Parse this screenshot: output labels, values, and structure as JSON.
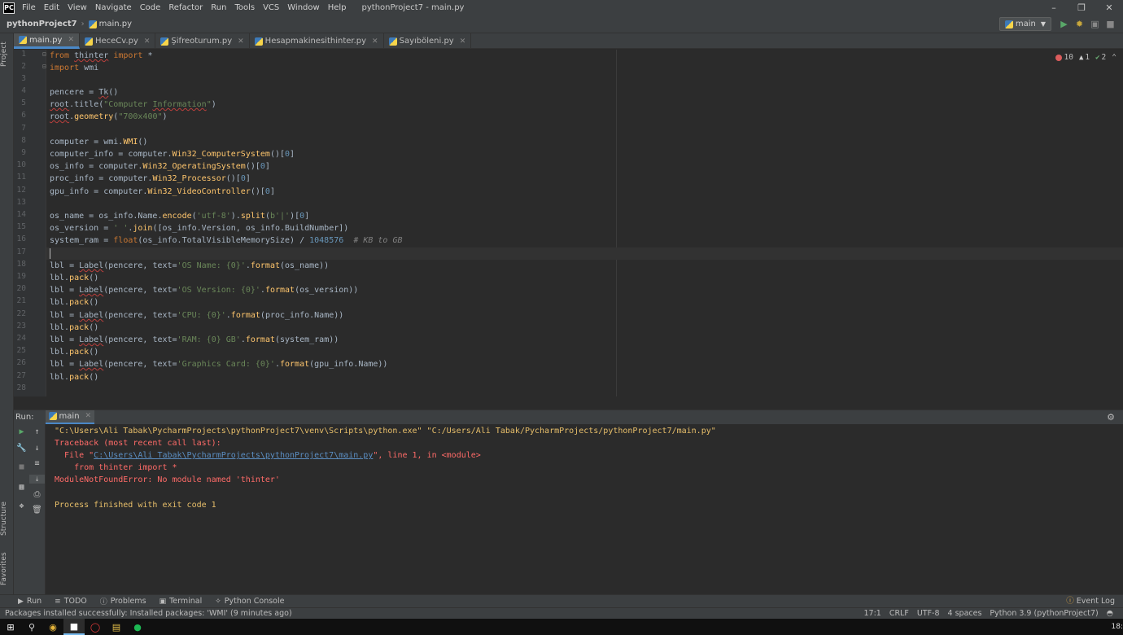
{
  "menubar": {
    "items": [
      "File",
      "Edit",
      "View",
      "Navigate",
      "Code",
      "Refactor",
      "Run",
      "Tools",
      "VCS",
      "Window",
      "Help"
    ],
    "window_title": "pythonProject7 - main.py"
  },
  "navbar": {
    "project": "pythonProject7",
    "file": "main.py",
    "run_config": "main"
  },
  "left_strip": {
    "project": "Project",
    "structure": "Structure",
    "favorites": "Favorites"
  },
  "tabs": [
    "main.py",
    "HeceCv.py",
    "Şifreoturum.py",
    "Hesapmakinesithinter.py",
    "Sayıböleni.py"
  ],
  "inspections": {
    "errors": "10",
    "warnings": "1",
    "typos": "2"
  },
  "run_panel": {
    "title": "Run:",
    "tab": "main",
    "lines": {
      "cmd": "\"C:\\Users\\Ali Tabak\\PycharmProjects\\pythonProject7\\venv\\Scripts\\python.exe\" \"C:/Users/Ali Tabak/PycharmProjects/pythonProject7/main.py\"",
      "traceback": "Traceback (most recent call last):",
      "file_pre": "  File \"",
      "file_link": "C:\\Users\\Ali Tabak\\PycharmProjects\\pythonProject7\\main.py",
      "file_post": "\", line 1, in <module>",
      "src": "    from thinter import *",
      "error": "ModuleNotFoundError: No module named 'thinter'",
      "exit": "Process finished with exit code 1"
    }
  },
  "toolwindows": [
    "Run",
    "TODO",
    "Problems",
    "Terminal",
    "Python Console"
  ],
  "event_log": "Event Log",
  "status": {
    "message": "Packages installed successfully: Installed packages: 'WMI' (9 minutes ago)",
    "position": "17:1",
    "line_sep": "CRLF",
    "encoding": "UTF-8",
    "indent": "4 spaces",
    "interpreter": "Python 3.9 (pythonProject7)"
  },
  "taskbar": {
    "clock": "18:"
  }
}
